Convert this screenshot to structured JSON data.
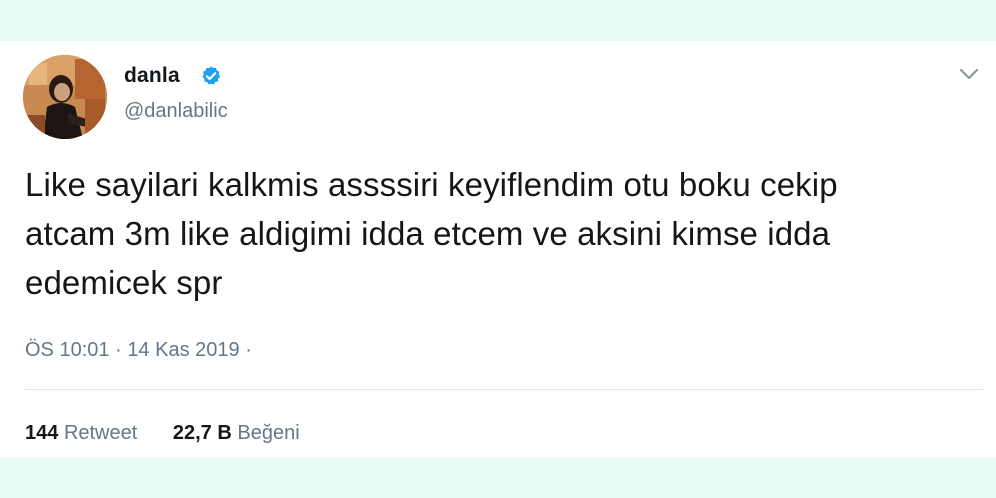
{
  "tweet": {
    "author": {
      "display_name": "danla",
      "handle": "@danlabilic",
      "verified": true,
      "avatar_icon": "profile-photo"
    },
    "text_lines": [
      "Like sayilari kalkmis assssiri keyiflendim otu boku cekip",
      "atcam 3m like aldigimi idda etcem ve aksini kimse idda",
      "edemicek spr"
    ],
    "timestamp": {
      "time": "ÖS 10:01",
      "separator": "·",
      "date": "14 Kas 2019",
      "trailing_dot": "·"
    },
    "stats": {
      "retweets": {
        "count": "144",
        "label": "Retweet"
      },
      "likes": {
        "count": "22,7 B",
        "label": "Beğeni"
      }
    },
    "menu_icon": "chevron-down-icon"
  },
  "colors": {
    "background_band": "#e8fbf4",
    "card": "#ffffff",
    "text_primary": "#14171a",
    "text_secondary": "#657786",
    "verified_blue": "#1da1f2",
    "divider": "#e1e8ed"
  }
}
